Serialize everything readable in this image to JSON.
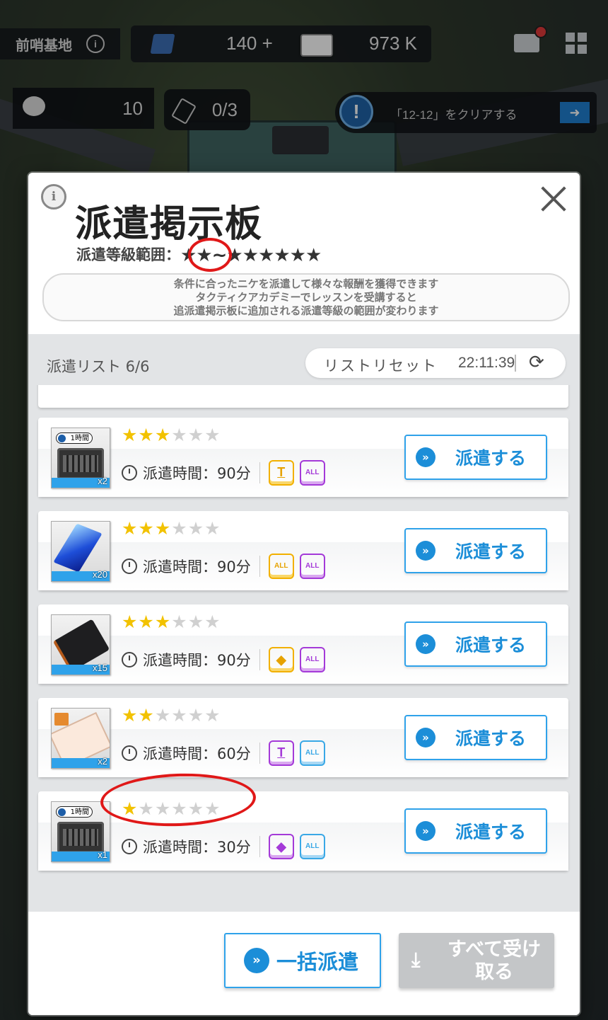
{
  "hud": {
    "base_name": "前哨基地",
    "gems": "140 +",
    "credits": "973 K",
    "chat_count": "10",
    "tickets": "0/3",
    "quest": "「12-12」をクリアする"
  },
  "modal": {
    "title": "派遣掲示板",
    "range_label": "派遣等級範囲：",
    "range_min_stars": "★★",
    "range_sep": "~",
    "range_max_stars": "★★★★★★",
    "desc_lines": [
      "条件に合ったニケを派遣して様々な報酬を獲得できます",
      "タクティクアカデミーでレッスンを受講すると",
      "追派遣掲示板に追加される派遣等級の範囲が変わります"
    ],
    "list_title": "派遣リスト 6/6",
    "reset_label": "リストリセット",
    "reset_timer": "22:11:39",
    "bulk_button": "一括派遣",
    "receive_button": "すべて受け取る"
  },
  "dispatches": [
    {
      "rank": 3,
      "max": 6,
      "item": "case-1h",
      "item_badge": "1時間",
      "qty": "x2",
      "duration": "派遣時間：90分",
      "badges": [
        {
          "style": "yellow",
          "label": "T"
        },
        {
          "style": "purple",
          "label": "ALL"
        }
      ],
      "button": "派遣する"
    },
    {
      "rank": 3,
      "max": 6,
      "item": "crystal",
      "item_badge": "",
      "qty": "x20",
      "duration": "派遣時間：90分",
      "badges": [
        {
          "style": "yellow",
          "label": "ALL"
        },
        {
          "style": "purple",
          "label": "ALL"
        }
      ],
      "button": "派遣する"
    },
    {
      "rank": 3,
      "max": 6,
      "item": "black-case",
      "item_badge": "",
      "qty": "x15",
      "duration": "派遣時間：90分",
      "badges": [
        {
          "style": "yellow",
          "label": "◆"
        },
        {
          "style": "purple",
          "label": "ALL"
        }
      ],
      "button": "派遣する"
    },
    {
      "rank": 2,
      "max": 6,
      "item": "ticket",
      "item_badge": "",
      "qty": "x2",
      "duration": "派遣時間：60分",
      "badges": [
        {
          "style": "purple",
          "label": "T"
        },
        {
          "style": "blue",
          "label": "ALL"
        }
      ],
      "button": "派遣する"
    },
    {
      "rank": 1,
      "max": 6,
      "item": "case-1h",
      "item_badge": "1時間",
      "qty": "x1",
      "duration": "派遣時間：30分",
      "badges": [
        {
          "style": "purple",
          "label": "◆"
        },
        {
          "style": "blue",
          "label": "ALL"
        }
      ],
      "button": "派遣する"
    }
  ],
  "colors": {
    "accent": "#1c8ed8",
    "star_on": "#f2c200",
    "star_off": "#d0d0d0",
    "annotation": "#e01818"
  }
}
